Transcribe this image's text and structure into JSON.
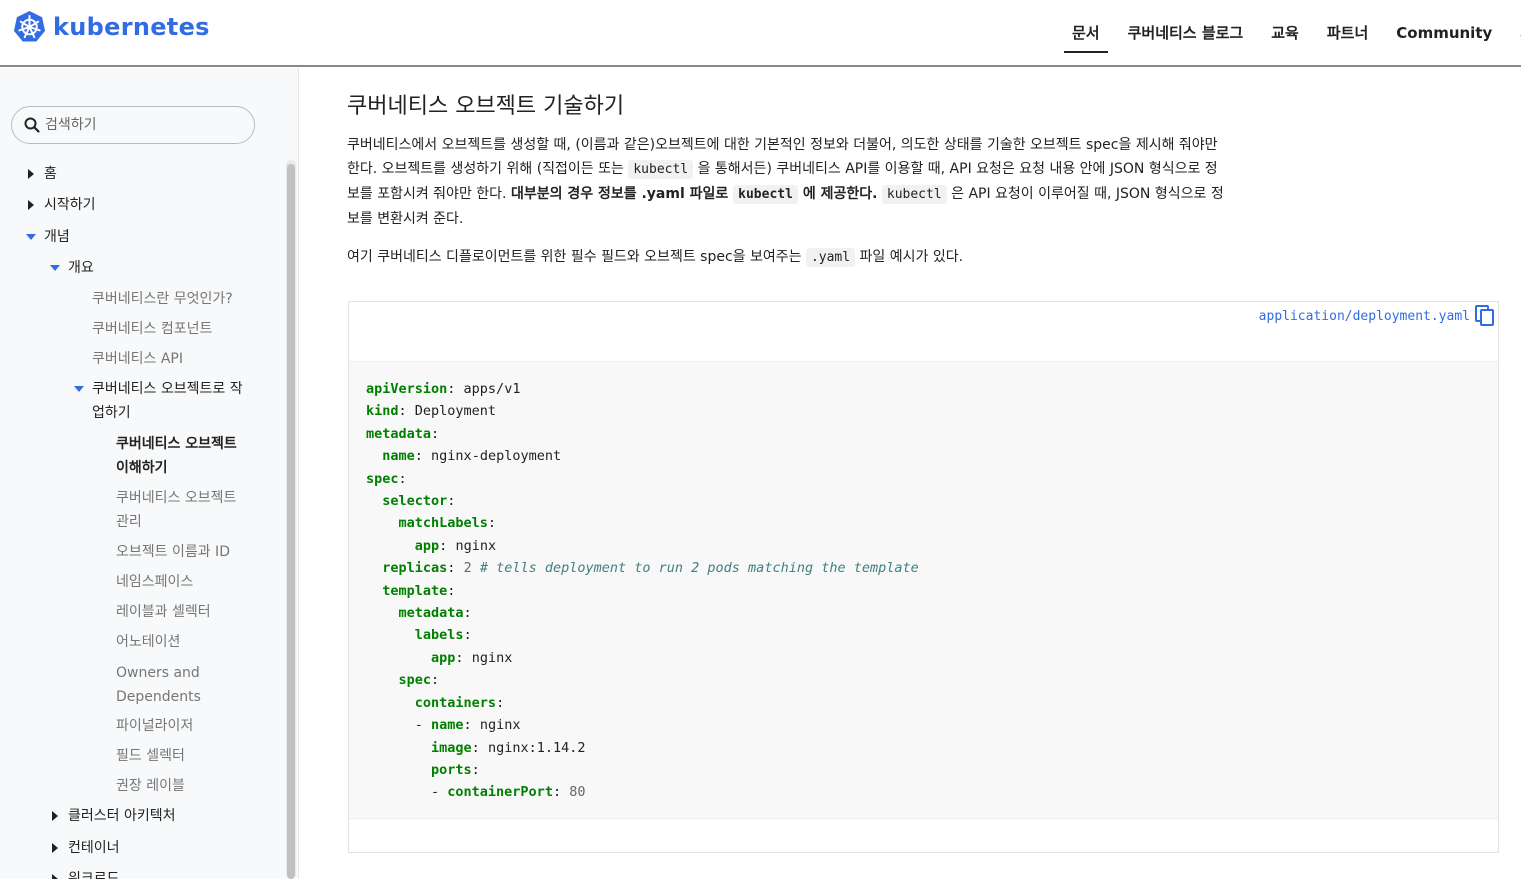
{
  "header": {
    "logo_text": "kubernetes",
    "nav": [
      "문서",
      "쿠버네티스 블로그",
      "교육",
      "파트너",
      "Community",
      "사례"
    ]
  },
  "sidebar": {
    "search_placeholder": "검색하기",
    "items": {
      "home": "홈",
      "getting_started": "시작하기",
      "concepts": "개념",
      "overview": "개요",
      "what_is": "쿠버네티스란 무엇인가?",
      "components": "쿠버네티스 컴포넌트",
      "api": "쿠버네티스 API",
      "working_with_objects_1": "쿠버네티스 오브젝트로 작",
      "working_with_objects_2": "업하기",
      "understanding_1": "쿠버네티스 오브젝트",
      "understanding_2": "이해하기",
      "management_1": "쿠버네티스 오브젝트",
      "management_2": "관리",
      "names": "오브젝트 이름과 ID",
      "namespaces": "네임스페이스",
      "labels": "레이블과 셀렉터",
      "annotations": "어노테이션",
      "owners_1": "Owners and",
      "owners_2": "Dependents",
      "finalizers": "파이널라이저",
      "field_selectors": "필드 셀렉터",
      "recommended_labels": "권장 레이블",
      "cluster_arch": "클러스터 아키텍처",
      "containers": "컨테이너",
      "workloads": "워크로드"
    }
  },
  "main": {
    "title": "쿠버네티스 오브젝트 기술하기",
    "para1": {
      "line1": "쿠버네티스에서 오브젝트를 생성할 때, (이름과 같은)오브젝트에 대한 기본적인 정보와 더불어, 의도한 상태를 기술한 오브젝트 spec을 제시해 줘야만",
      "line2a": "한다. 오브젝트를 생성하기 위해 (직접이든 또는 ",
      "code_kubectl": "kubectl",
      "line2b": " 을 통해서든) 쿠버네티스 API를 이용할 때, API 요청은 요청 내용 안에 JSON 형식으로 정",
      "line3a": "보를 포함시켜 줘야만 한다. ",
      "bold1": "대부분의 경우 정보를 .yaml 파일로 ",
      "bold_code": "kubectl",
      "bold2": " 에 제공한다.",
      "line3b": " 은 API 요청이 이루어질 때, JSON 형식으로 정",
      "line4": "보를 변환시켜 준다."
    },
    "para2": {
      "before": "여기 쿠버네티스 디플로이먼트를 위한 필수 필드와 오브젝트 spec을 보여주는 ",
      "code": ".yaml",
      "after": " 파일 예시가 있다."
    },
    "code_file": "application/deployment.yaml",
    "code": {
      "l1k": "apiVersion",
      "l1v": " apps/v1",
      "l2k": "kind",
      "l2v": " Deployment",
      "l3k": "metadata",
      "l4k": "name",
      "l4v": " nginx-deployment",
      "l5k": "spec",
      "l6k": "selector",
      "l7k": "matchLabels",
      "l8k": "app",
      "l8v": " nginx",
      "l9k": "replicas",
      "l9n": "2",
      "l9c": "# tells deployment to run 2 pods matching the template",
      "l10k": "template",
      "l11k": "metadata",
      "l12k": "labels",
      "l13k": "app",
      "l13v": " nginx",
      "l14k": "spec",
      "l15k": "containers",
      "l16k": "name",
      "l16v": " nginx",
      "l17k": "image",
      "l17v": " nginx:1.14.2",
      "l18k": "ports",
      "l19k": "containerPort",
      "l19n": "80"
    }
  }
}
